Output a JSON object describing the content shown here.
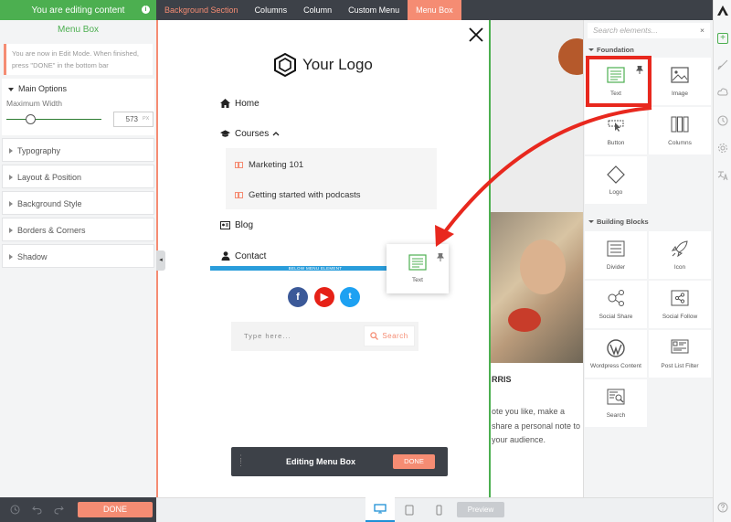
{
  "top": {
    "edit_banner": "You are editing content",
    "breadcrumbs": [
      "Background Section",
      "Columns",
      "Column",
      "Custom Menu",
      "Menu Box"
    ]
  },
  "left_panel": {
    "title": "Menu Box",
    "notice": "You are now in Edit Mode. When finished, press \"DONE\" in the bottom bar",
    "main_options": "Main Options",
    "max_width_label": "Maximum Width",
    "max_width_value": "573",
    "max_width_unit": "PX",
    "slider_fraction": 0.25,
    "sections": [
      "Typography",
      "Layout & Position",
      "Background Style",
      "Borders & Corners",
      "Shadow"
    ],
    "done": "DONE"
  },
  "canvas": {
    "logo_text": "Your Logo",
    "menu": {
      "home": "Home",
      "courses": "Courses",
      "sub_items": [
        "Marketing 101",
        "Getting started with podcasts"
      ],
      "blog": "Blog",
      "contact": "Contact"
    },
    "below_menu": "BELOW MENU ELEMENT",
    "search_placeholder": "Type here...",
    "search_button": "Search",
    "drag_card_label": "Text",
    "edit_bar_label": "Editing Menu Box",
    "edit_bar_done": "DONE",
    "bg_heading": "RRIS",
    "bg_lines": [
      "ote you like, make a",
      "share a personal note to",
      "your audience."
    ]
  },
  "bottom": {
    "preview": "Preview"
  },
  "right_panel": {
    "search_placeholder": "Search elements...",
    "groups": [
      "Foundation",
      "Building Blocks"
    ],
    "foundation": [
      "Text",
      "Image",
      "Button",
      "Columns",
      "Logo"
    ],
    "building_blocks": [
      "Divider",
      "Icon",
      "Social Share",
      "Social Follow",
      "Wordpress Content",
      "Post List Filter",
      "Search"
    ]
  },
  "colors": {
    "accent": "#f58c73",
    "green": "#4caf50",
    "dark": "#3d4148",
    "blue": "#2a9ddb",
    "highlight_red": "#e8281e"
  }
}
